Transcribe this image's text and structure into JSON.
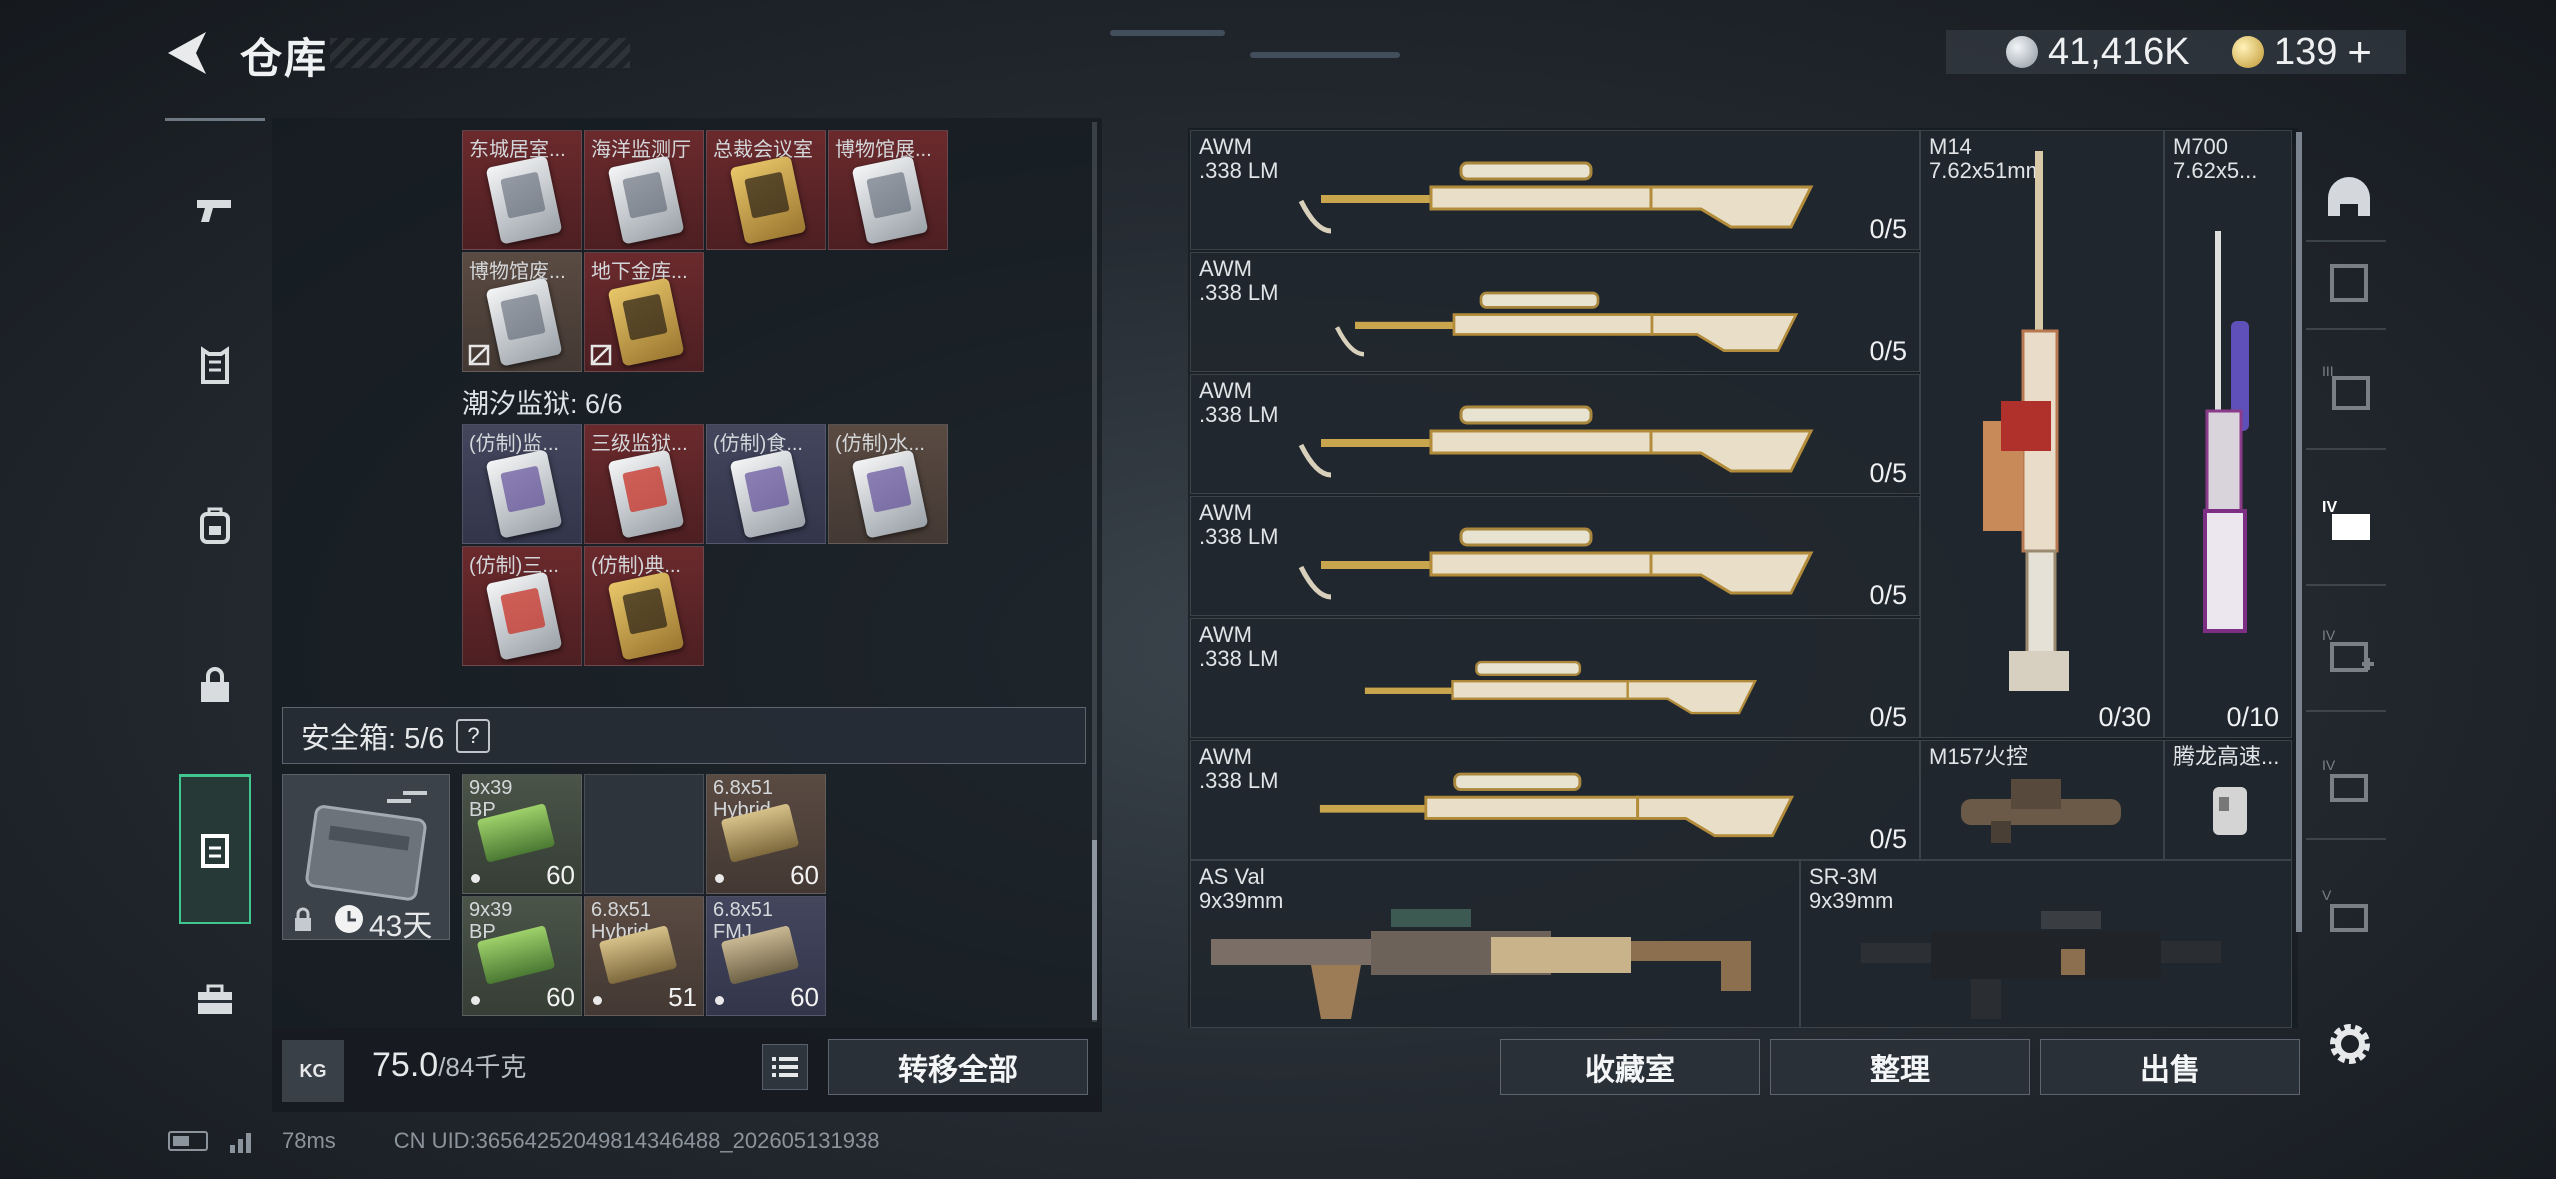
{
  "header": {
    "title": "仓库",
    "silver_amount": "41,416K",
    "gold_amount": "139",
    "plus": "+"
  },
  "left_nav": {
    "items": [
      "pistol-icon",
      "armor-vest-icon",
      "backpack-icon",
      "bag-icon",
      "storage-box-icon",
      "briefcase-icon"
    ],
    "active": "storage-box-icon"
  },
  "keycards": {
    "row1": [
      {
        "label": "东城居室...",
        "bg": "red",
        "card": "silver"
      },
      {
        "label": "海洋监测厅",
        "bg": "red",
        "card": "silver"
      },
      {
        "label": "总裁会议室",
        "bg": "red",
        "card": "gold"
      },
      {
        "label": "博物馆展...",
        "bg": "red",
        "card": "silver"
      }
    ],
    "row2": [
      {
        "label": "博物馆废...",
        "bg": "brown",
        "card": "silver",
        "broken": true
      },
      {
        "label": "地下金库...",
        "bg": "red",
        "card": "gold",
        "broken": true
      }
    ],
    "prison_label": "潮汐监狱: 6/6",
    "row3": [
      {
        "label": "(仿制)监...",
        "bg": "blue",
        "card": "purple"
      },
      {
        "label": "三级监狱...",
        "bg": "red",
        "card": "red"
      },
      {
        "label": "(仿制)食...",
        "bg": "blue",
        "card": "purple"
      },
      {
        "label": "(仿制)水...",
        "bg": "brown",
        "card": "purple"
      }
    ],
    "row4": [
      {
        "label": "(仿制)三...",
        "bg": "red",
        "card": "red"
      },
      {
        "label": "(仿制)典...",
        "bg": "red",
        "card": "gold"
      }
    ]
  },
  "safe_box": {
    "label": "安全箱: 5/6",
    "help": "?",
    "days_left": "43天",
    "items": [
      {
        "label": "9x39\nBP",
        "count": "60",
        "ammo": "green"
      },
      {
        "label": "",
        "count": "",
        "ammo": ""
      },
      {
        "label": "6.8x51\nHybrid",
        "count": "60",
        "ammo": "gold"
      },
      {
        "label": "9x39\nBP",
        "count": "60",
        "ammo": "green"
      },
      {
        "label": "6.8x51\nHybrid",
        "count": "51",
        "ammo": "gold"
      },
      {
        "label": "6.8x51\nFMJ",
        "count": "60",
        "ammo": "tan"
      }
    ]
  },
  "weight": {
    "current": "75.0",
    "max": "/84千克",
    "kg_icon": "KG"
  },
  "buttons": {
    "transfer_all": "转移全部",
    "collection": "收藏室",
    "organize": "整理",
    "sell": "出售"
  },
  "weapons": {
    "awm": [
      {
        "name": "AWM",
        "caliber": ".338 LM",
        "ammo": "0/5"
      },
      {
        "name": "AWM",
        "caliber": ".338 LM",
        "ammo": "0/5"
      },
      {
        "name": "AWM",
        "caliber": ".338 LM",
        "ammo": "0/5"
      },
      {
        "name": "AWM",
        "caliber": ".338 LM",
        "ammo": "0/5"
      },
      {
        "name": "AWM",
        "caliber": ".338 LM",
        "ammo": "0/5"
      },
      {
        "name": "AWM",
        "caliber": ".338 LM",
        "ammo": "0/5"
      }
    ],
    "m14": {
      "name": "M14",
      "caliber": "7.62x51mm",
      "ammo": "0/30"
    },
    "m700": {
      "name": "M700",
      "caliber": "7.62x5...",
      "ammo": "0/10"
    },
    "m157": {
      "name": "M157火控"
    },
    "tenglong": {
      "name": "腾龙高速..."
    },
    "asval": {
      "name": "AS Val",
      "caliber": "9x39mm"
    },
    "sr3m": {
      "name": "SR-3M",
      "caliber": "9x39mm"
    }
  },
  "right_categories": [
    "helmet-icon",
    "armor-icon",
    "armor-tier3-icon",
    "armor-tier4-icon",
    "medkit-tier4-icon",
    "tool-tier4-icon",
    "tool-tier5-icon"
  ],
  "status": {
    "ping": "78ms",
    "uid": "CN UID:3656425204981434648​8_202605131938"
  },
  "colors": {
    "accent": "#3fc78f",
    "red_cell": "#6b2a2d",
    "gold": "#c09631"
  }
}
